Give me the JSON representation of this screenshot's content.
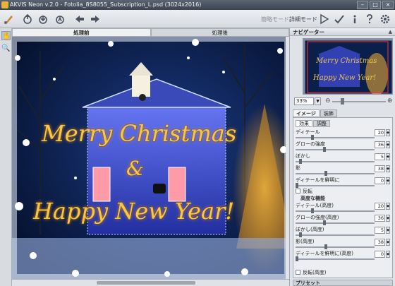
{
  "window": {
    "title": "AKVIS Neon v.2.0 - Fotolia_8S8055_Subscription_L.psd (3024x2016)",
    "minimize": "–",
    "maximize": "□",
    "close": "×"
  },
  "toolbar": {
    "mode_express": "簡略モード",
    "mode_advanced": "詳細モード",
    "icons": [
      "brush-logo-icon",
      "open-icon",
      "save-icon",
      "upload-icon",
      "undo-icon",
      "redo-icon",
      "run-icon",
      "apply-icon",
      "info-icon",
      "help-icon",
      "settings-icon"
    ]
  },
  "canvas_tabs": {
    "before": "処理前",
    "after": "処理後"
  },
  "canvas": {
    "line1": "Merry Christmas",
    "line2": "&",
    "line3": "Happy New Year!"
  },
  "navigator": {
    "title": "ナビゲーター",
    "zoom": "33%",
    "preview_line1": "Merry Christmas",
    "preview_line2": "Happy New Year!"
  },
  "settings": {
    "tab_image": "イメージ",
    "tab_decoration": "装飾",
    "subtab_effect": "効果",
    "subtab_adjust": "調整",
    "params": [
      {
        "label": "ディテール",
        "value": "20",
        "fraction": 0.2
      },
      {
        "label": "グローの強度",
        "value": "36",
        "fraction": 0.36
      },
      {
        "label": "ぼかし",
        "value": "5",
        "fraction": 0.05
      },
      {
        "label": "影",
        "value": "38",
        "fraction": 0.38
      },
      {
        "label": "ディテールを鮮明に",
        "value": "0",
        "fraction": 0.0
      }
    ],
    "invert_label": "反転",
    "advanced_title": "高度な機能",
    "advanced_params": [
      {
        "label": "ディテール(高度)",
        "value": "20",
        "fraction": 0.2
      },
      {
        "label": "グローの強度(高度)",
        "value": "36",
        "fraction": 0.36
      },
      {
        "label": "ぼかし(高度)",
        "value": "5",
        "fraction": 0.05
      },
      {
        "label": "影(高度)",
        "value": "38",
        "fraction": 0.38
      },
      {
        "label": "ディテールを鮮明に(高度)",
        "value": "0",
        "fraction": 0.0
      }
    ],
    "invert_advanced_label": "反転(高度)"
  },
  "presets": {
    "title": "プリセット"
  },
  "colors": {
    "title_bg": "#3b434f",
    "canvas_bg": "#06183a",
    "text_gold": "#f6c84a",
    "neon_blue": "#4a6cff"
  }
}
